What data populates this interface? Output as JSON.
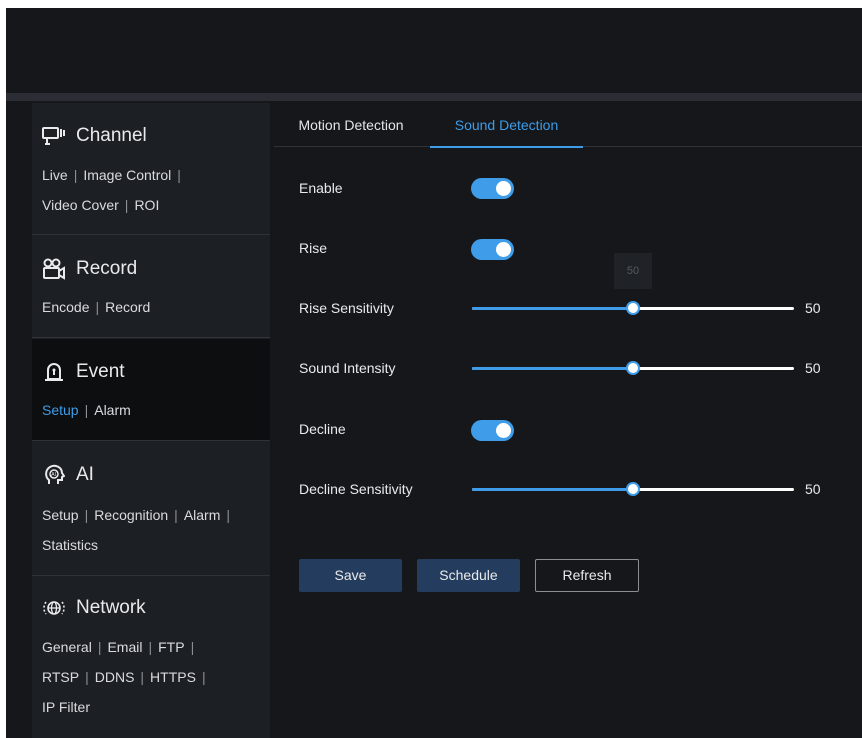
{
  "sidebar": {
    "channel": {
      "title": "Channel",
      "icon": "monitor-icon",
      "links": [
        "Live",
        "Image Control",
        "Video Cover",
        "ROI"
      ]
    },
    "record": {
      "title": "Record",
      "icon": "camera-icon",
      "links": [
        "Encode",
        "Record"
      ]
    },
    "event": {
      "title": "Event",
      "icon": "alarm-bell-icon",
      "links": [
        "Setup",
        "Alarm"
      ],
      "selected": "Setup"
    },
    "ai": {
      "title": "AI",
      "icon": "ai-head-icon",
      "links": [
        "Setup",
        "Recognition",
        "Alarm",
        "Statistics"
      ]
    },
    "network": {
      "title": "Network",
      "icon": "globe-icon",
      "links": [
        "General",
        "Email",
        "FTP",
        "RTSP",
        "DDNS",
        "HTTPS",
        "IP Filter"
      ]
    }
  },
  "tabs": [
    {
      "label": "Motion Detection",
      "active": false
    },
    {
      "label": "Sound Detection",
      "active": true
    }
  ],
  "form": {
    "enable": {
      "label": "Enable",
      "on": true
    },
    "rise": {
      "label": "Rise",
      "on": true
    },
    "rise_sensitivity": {
      "label": "Rise Sensitivity",
      "value": "50",
      "percent": 50
    },
    "sound_intensity": {
      "label": "Sound Intensity",
      "value": "50",
      "percent": 50
    },
    "decline": {
      "label": "Decline",
      "on": true
    },
    "decline_sensitivity": {
      "label": "Decline Sensitivity",
      "value": "50",
      "percent": 50
    },
    "tooltip": "50"
  },
  "buttons": {
    "save": "Save",
    "schedule": "Schedule",
    "refresh": "Refresh"
  },
  "colors": {
    "accent": "#3e9ce8",
    "background": "#15171b",
    "sidebar": "#1c1f24",
    "button_primary": "#243d5e"
  }
}
